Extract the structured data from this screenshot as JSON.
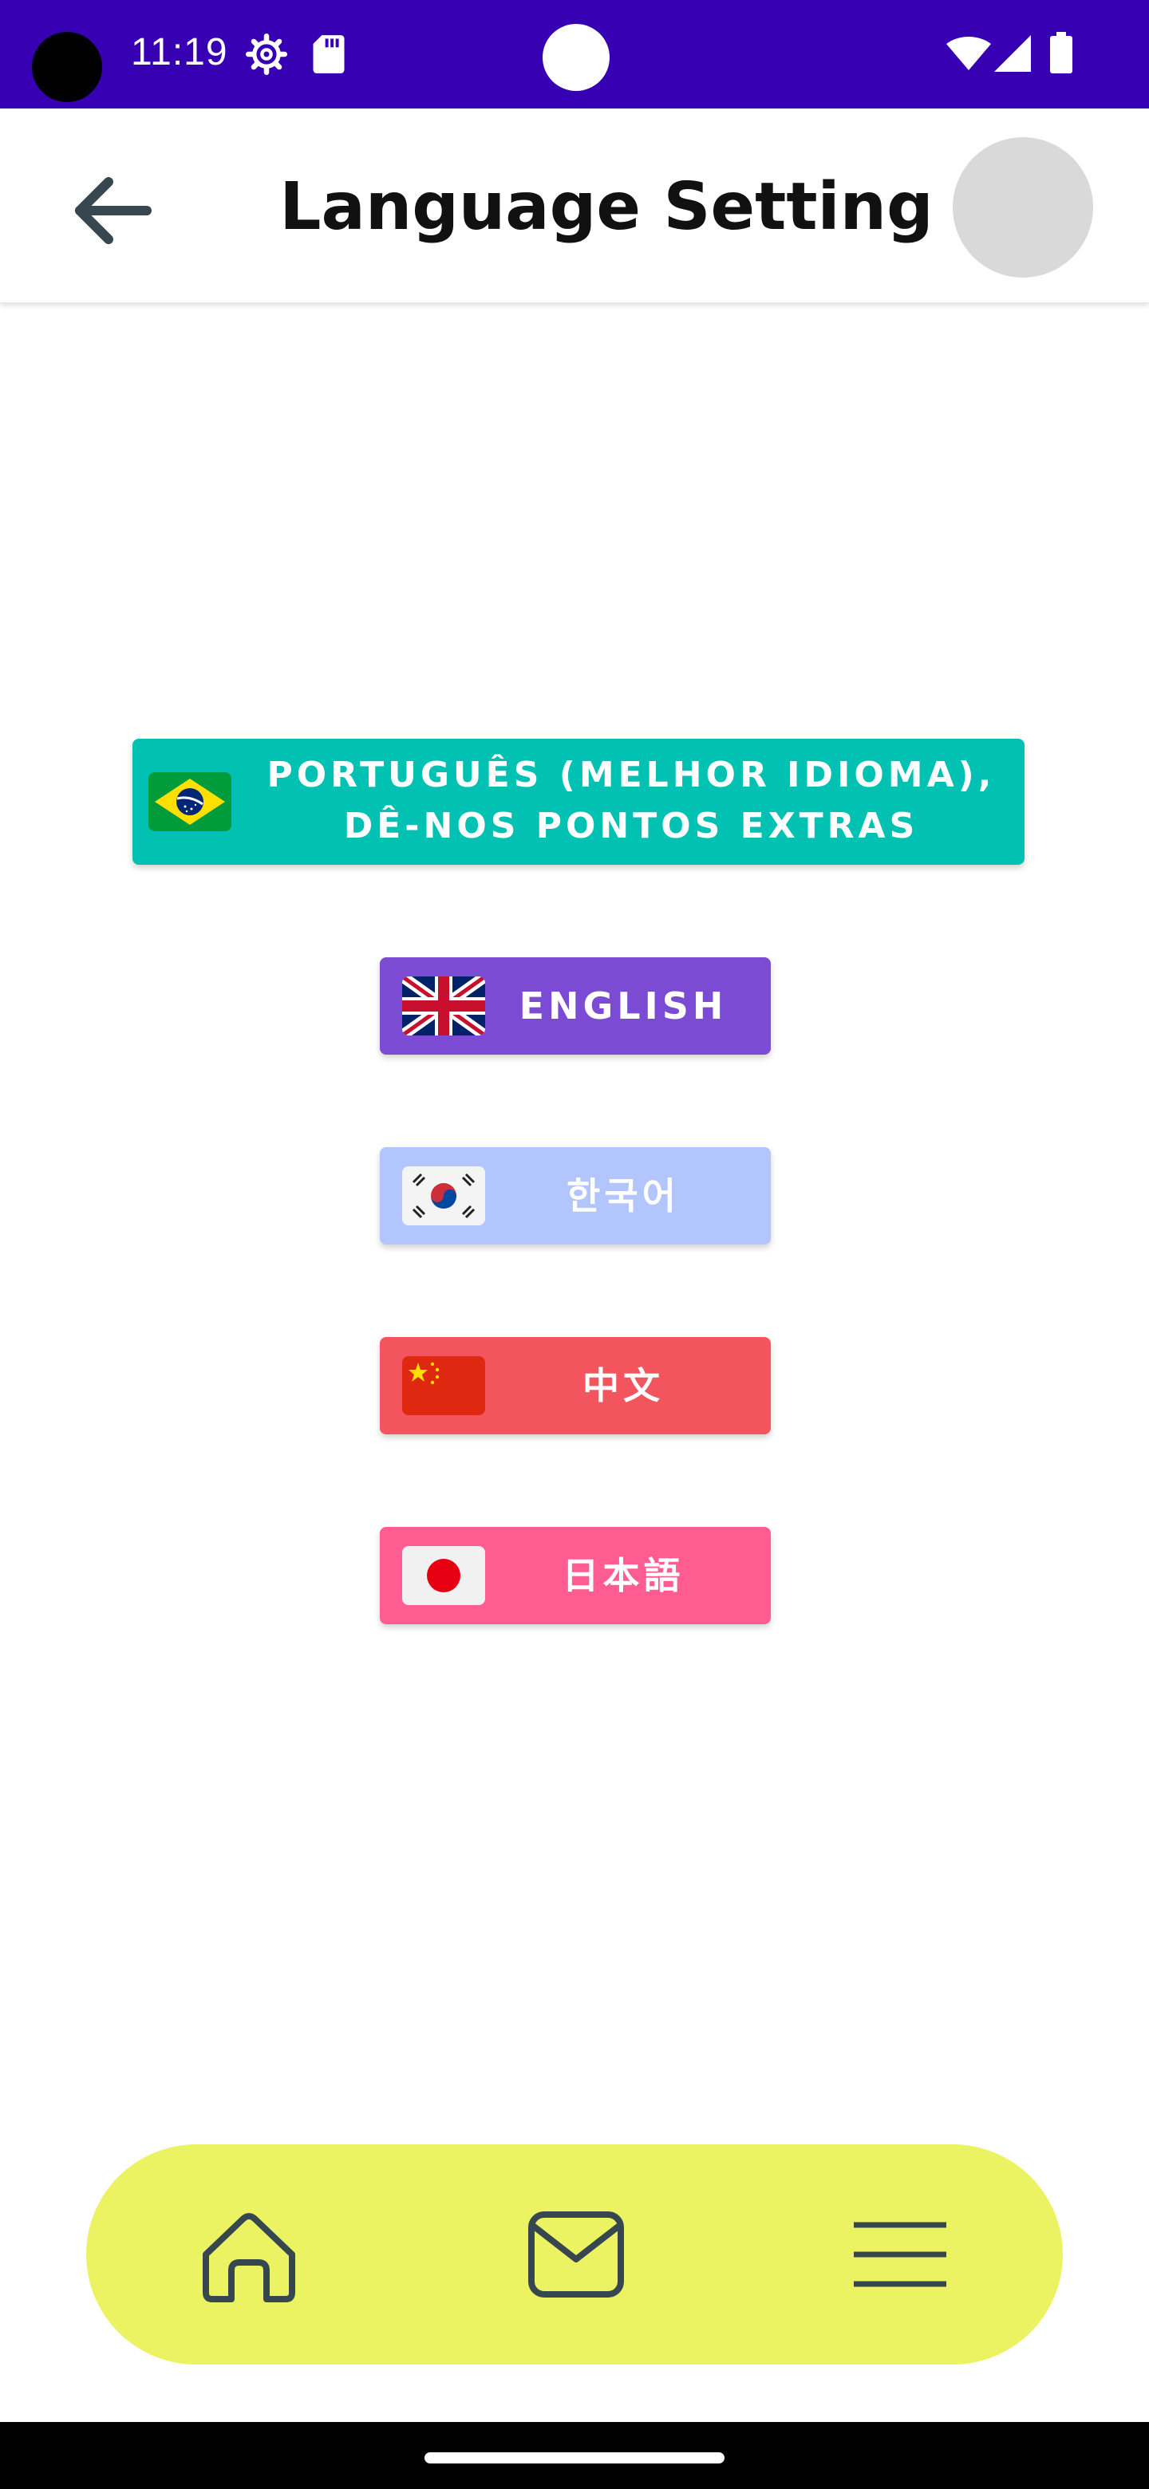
{
  "status_bar": {
    "time": "11:19",
    "icons": [
      "settings-gear-icon",
      "sd-card-icon",
      "wifi-icon",
      "signal-icon",
      "battery-icon"
    ]
  },
  "header": {
    "title": "Language Setting",
    "back_icon": "arrow-left-icon"
  },
  "languages": {
    "portuguese": {
      "label_line1": "PORTUGUÊS (MELHOR IDIOMA),",
      "label_line2": "DÊ-NOS PONTOS EXTRAS",
      "flag": "brazil-flag-icon",
      "color": "#00c1b2"
    },
    "english": {
      "label": "ENGLISH",
      "flag": "uk-flag-icon",
      "color": "#7b4bd4"
    },
    "korean": {
      "label": "한국어",
      "flag": "south-korea-flag-icon",
      "color": "#b2c5fd"
    },
    "chinese": {
      "label": "中文",
      "flag": "china-flag-icon",
      "color": "#f3555f"
    },
    "japanese": {
      "label": "日本語",
      "flag": "japan-flag-icon",
      "color": "#ff5c92"
    }
  },
  "bottom_nav": {
    "background": "#ecf362",
    "items": [
      "home-icon",
      "mail-icon",
      "menu-icon"
    ]
  },
  "colors": {
    "status_bar": "#3700b3",
    "icon_stroke": "#37474f"
  }
}
